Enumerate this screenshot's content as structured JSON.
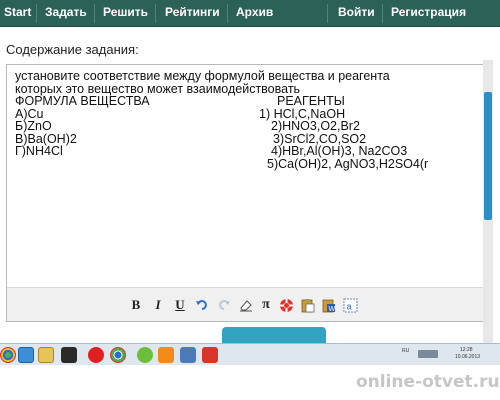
{
  "nav": {
    "items": [
      {
        "label": "Start"
      },
      {
        "label": "Задать"
      },
      {
        "label": "Решить"
      },
      {
        "label": "Рейтинги"
      },
      {
        "label": "Архив"
      },
      {
        "label": "Войти"
      },
      {
        "label": "Регистрация"
      }
    ],
    "bg_color": "#2c6157"
  },
  "content_label": "Содержание задания:",
  "editor": {
    "lines": [
      {
        "left": "установите соответствие между формулой вещества и реагента",
        "right": ""
      },
      {
        "left": "которых это вещество может взаимодействовать",
        "right": ""
      },
      {
        "left": "ФОРМУЛА ВЕЩЕСТВА",
        "right": "РЕАГЕНТЫ"
      },
      {
        "left": "А)Cu",
        "right": "1) HCl,C,NaOH"
      },
      {
        "left": "Б)ZnO",
        "right": "2)HNO3,O2,Br2"
      },
      {
        "left": "В)Ba(OH)2",
        "right": "3)SrCl2,CO,SO2"
      },
      {
        "left": "Г)NH4Cl",
        "right": "4)HBr,Al(OH)3, Na2CO3"
      },
      {
        "left": "",
        "right": "5)Ca(OH)2, AgNO3,H2SO4(r"
      }
    ],
    "toolbar": {
      "bold": "B",
      "italic": "I",
      "underline": "U",
      "pi": "π"
    }
  },
  "taskbar": {
    "lang": "RU",
    "time": "12:28",
    "date": "10.06.2013"
  },
  "watermark": "online-otvet.ru",
  "colors": {
    "accent": "#32a4c3",
    "scroll_thumb": "#2a8fc6"
  }
}
